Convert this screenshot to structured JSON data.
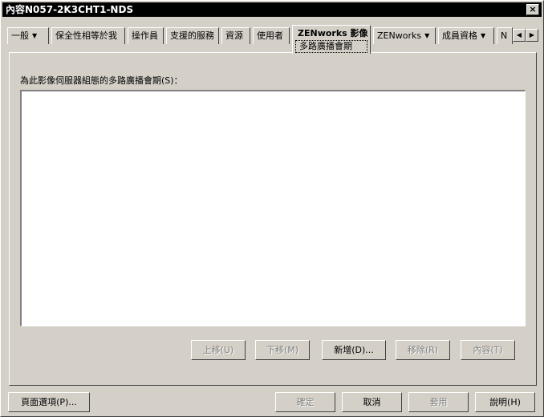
{
  "window": {
    "title": "內容N057-2K3CHT1-NDS",
    "close_label": "×"
  },
  "tabs": [
    {
      "label": "一般",
      "dropdown": true
    },
    {
      "label": "保全性相等於我",
      "dropdown": false
    },
    {
      "label": "操作員",
      "dropdown": false
    },
    {
      "label": "支援的服務",
      "dropdown": false
    },
    {
      "label": "資源",
      "dropdown": false
    },
    {
      "label": "使用者",
      "dropdown": false
    },
    {
      "label": "ZENworks 影像",
      "sub": "多路廣播會期",
      "active": true
    },
    {
      "label": "ZENworks",
      "dropdown": true
    },
    {
      "label": "成員資格",
      "dropdown": true
    },
    {
      "label": "N",
      "dropdown": false
    }
  ],
  "tab_scroll": {
    "left": "◀",
    "right": "▶"
  },
  "main": {
    "list_label": "為此影像伺服器組態的多路廣播會期(S)：",
    "buttons": {
      "move_up": "上移(U)",
      "move_down": "下移(M)",
      "add": "新增(D)...",
      "remove": "移除(R)",
      "properties": "內容(T)"
    }
  },
  "footer": {
    "page_options": "頁面選項(P)...",
    "ok": "確定",
    "cancel": "取消",
    "apply": "套用",
    "help": "說明(H)"
  },
  "colors": {
    "face": "#d4d0c8",
    "title_bg": "#000000",
    "list_bg": "#ffffff"
  }
}
